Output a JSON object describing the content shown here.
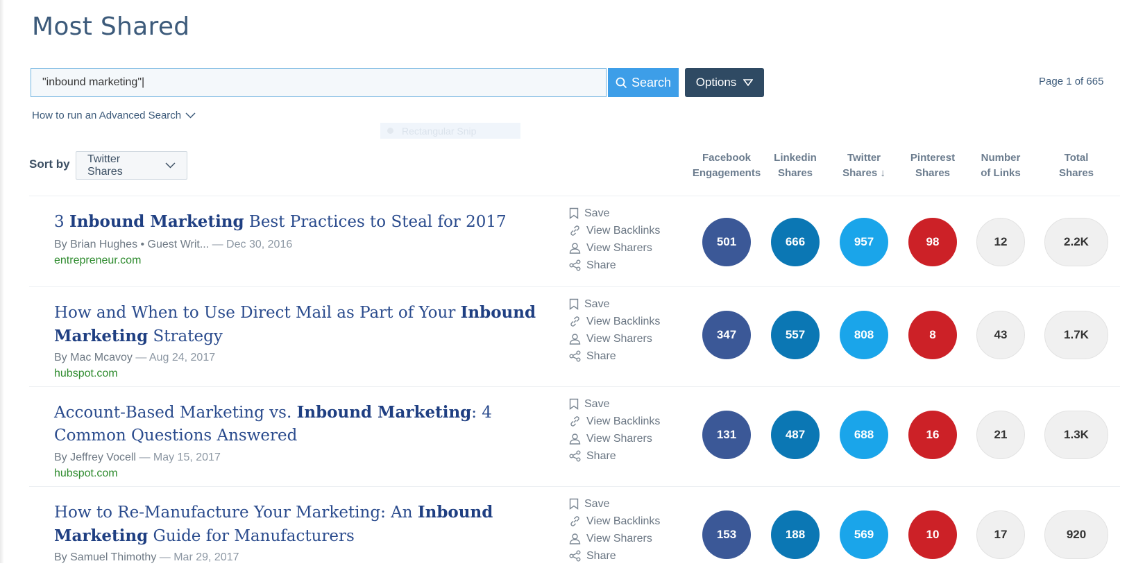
{
  "page": {
    "title": "Most Shared",
    "page_info": "Page 1 of 665"
  },
  "search": {
    "value": "\"inbound marketing\"|",
    "button_label": "Search",
    "options_label": "Options"
  },
  "advanced_search_label": "How to run an Advanced Search",
  "snip_overlay_label": "Rectangular Snip",
  "sort": {
    "label": "Sort by",
    "selected": "Twitter Shares"
  },
  "columns": [
    {
      "line1": "Facebook",
      "line2": "Engagements"
    },
    {
      "line1": "Linkedin",
      "line2": "Shares"
    },
    {
      "line1": "Twitter",
      "line2": "Shares ↓"
    },
    {
      "line1": "Pinterest",
      "line2": "Shares"
    },
    {
      "line1": "Number",
      "line2": "of Links"
    },
    {
      "line1": "Total",
      "line2": "Shares"
    }
  ],
  "action_labels": {
    "save": "Save",
    "backlinks": "View Backlinks",
    "sharers": "View Sharers",
    "share": "Share"
  },
  "results": [
    {
      "title_parts": [
        {
          "text": "3 ",
          "bold": false
        },
        {
          "text": "Inbound Marketing",
          "bold": true
        },
        {
          "text": " Best Practices to Steal for 2017",
          "bold": false
        }
      ],
      "author": "By Brian Hughes • Guest Writ...",
      "date": "— Dec 30, 2016",
      "domain": "entrepreneur.com",
      "facebook": "501",
      "linkedin": "666",
      "twitter": "957",
      "pinterest": "98",
      "links": "12",
      "total": "2.2K"
    },
    {
      "title_parts": [
        {
          "text": "How and When to Use Direct Mail as Part of Your ",
          "bold": false
        },
        {
          "text": "Inbound Marketing",
          "bold": true
        },
        {
          "text": " Strategy",
          "bold": false
        }
      ],
      "author": "By Mac Mcavoy",
      "date": "— Aug 24, 2017",
      "domain": "hubspot.com",
      "facebook": "347",
      "linkedin": "557",
      "twitter": "808",
      "pinterest": "8",
      "links": "43",
      "total": "1.7K"
    },
    {
      "title_parts": [
        {
          "text": "Account-Based Marketing vs. ",
          "bold": false
        },
        {
          "text": "Inbound Marketing",
          "bold": true
        },
        {
          "text": ": 4 Common Questions Answered",
          "bold": false
        }
      ],
      "author": "By Jeffrey Vocell",
      "date": "— May 15, 2017",
      "domain": "hubspot.com",
      "facebook": "131",
      "linkedin": "487",
      "twitter": "688",
      "pinterest": "16",
      "links": "21",
      "total": "1.3K"
    },
    {
      "title_parts": [
        {
          "text": "How to Re-Manufacture Your Marketing: An ",
          "bold": false
        },
        {
          "text": "Inbound Marketing",
          "bold": true
        },
        {
          "text": " Guide for Manufacturers",
          "bold": false
        }
      ],
      "author": "By Samuel Thimothy",
      "date": "— Mar 29, 2017",
      "domain": "",
      "facebook": "153",
      "linkedin": "188",
      "twitter": "569",
      "pinterest": "10",
      "links": "17",
      "total": "920"
    }
  ],
  "colors": {
    "facebook": "#3b5897",
    "linkedin": "#0b77b4",
    "twitter": "#1aa5ea",
    "pinterest": "#cc2127",
    "title": "#2a4b8d",
    "domain": "#2e8b2e"
  }
}
